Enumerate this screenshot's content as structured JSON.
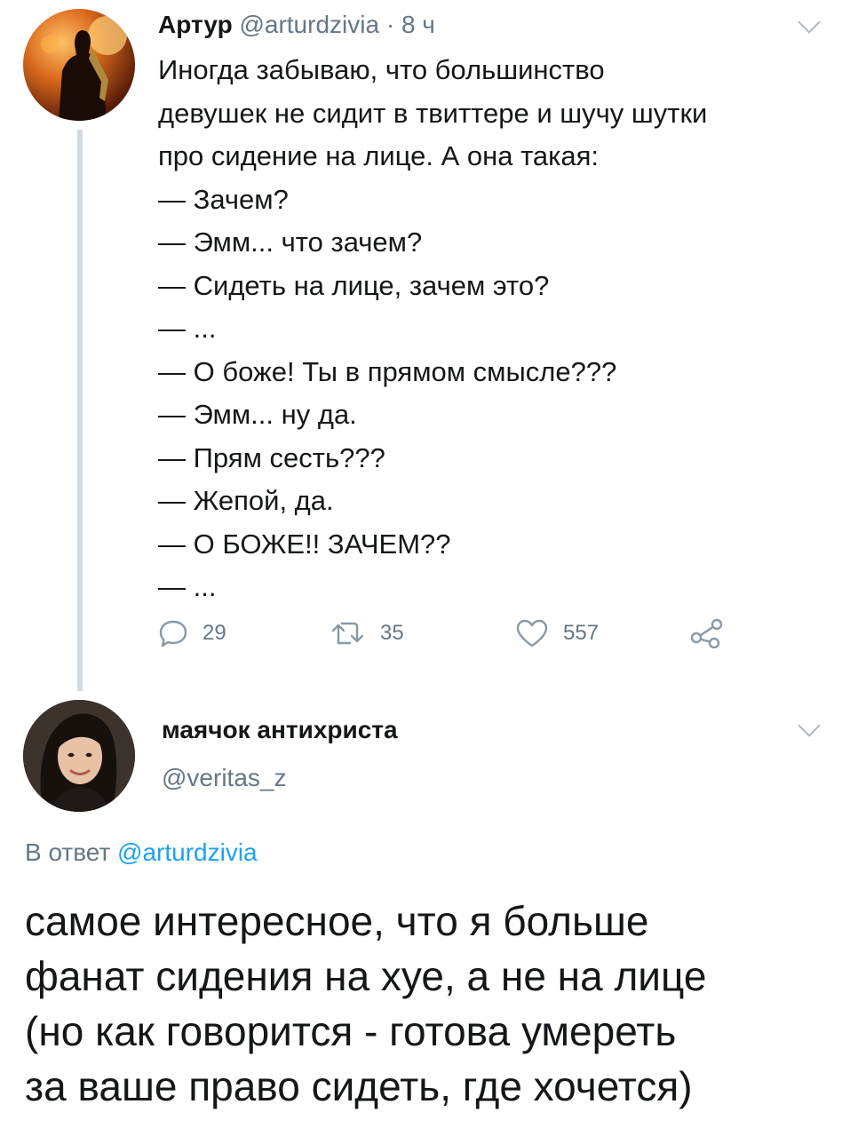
{
  "tweet1": {
    "display_name": "Артур",
    "handle": "@arturdzivia",
    "separator": "·",
    "time": "8 ч",
    "lines": [
      "Иногда забываю, что большинство",
      "девушек не сидит в твиттере и шучу шутки",
      "про сидение на лице. А она такая:",
      "— Зачем?",
      "— Эмм... что зачем?",
      "— Сидеть на лице, зачем это?",
      "— ...",
      "— О боже! Ты в прямом смысле???",
      "— Эмм... ну да.",
      "— Прям сесть???",
      "— Жепой, да.",
      "— О БОЖЕ!! ЗАЧЕМ??",
      "— ..."
    ],
    "actions": {
      "replies": "29",
      "retweets": "35",
      "likes": "557"
    }
  },
  "tweet2": {
    "display_name": "маячок антихриста",
    "handle": "@veritas_z",
    "reply_prefix": "В ответ",
    "reply_to": "@arturdzivia",
    "lines": [
      "самое интересное, что я больше",
      "фанат сидения на хуе, а не на лице",
      "(но как говорится - готова умереть",
      "за ваше право сидеть, где хочется)"
    ]
  },
  "colors": {
    "text": "#14171a",
    "secondary": "#657786",
    "link": "#1da1f2",
    "thread_line": "#d3dbe2"
  },
  "icons": [
    "reply-icon",
    "retweet-icon",
    "like-icon",
    "share-icon",
    "chevron-down-icon"
  ]
}
